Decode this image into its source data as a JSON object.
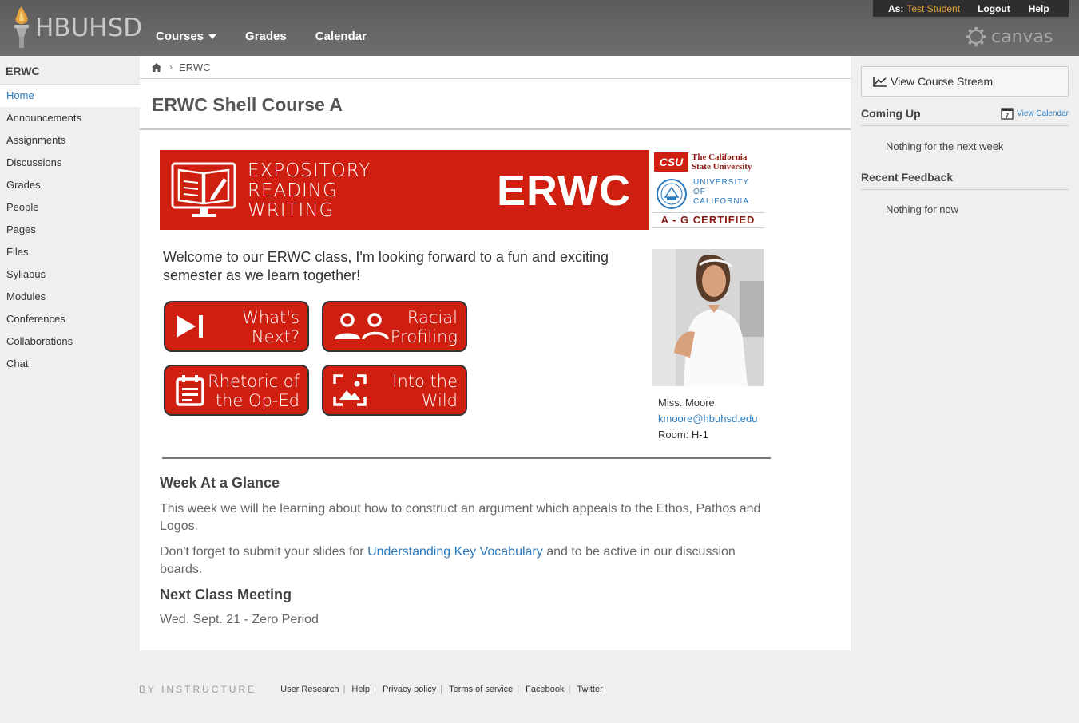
{
  "header": {
    "logo_text": "HBUHSD",
    "nav": {
      "courses": "Courses",
      "grades": "Grades",
      "calendar": "Calendar"
    },
    "user": {
      "as_label": "As:",
      "user_name": "Test Student",
      "logout": "Logout",
      "help": "Help"
    },
    "brand": "canvas",
    "colors": {
      "accent_user": "#e8a33d",
      "bar_bg": "#5c5c5c"
    }
  },
  "sidebar": {
    "course": "ERWC",
    "items": [
      {
        "label": "Home"
      },
      {
        "label": "Announcements"
      },
      {
        "label": "Assignments"
      },
      {
        "label": "Discussions"
      },
      {
        "label": "Grades"
      },
      {
        "label": "People"
      },
      {
        "label": "Pages"
      },
      {
        "label": "Files"
      },
      {
        "label": "Syllabus"
      },
      {
        "label": "Modules"
      },
      {
        "label": "Conferences"
      },
      {
        "label": "Collaborations"
      },
      {
        "label": "Chat"
      }
    ]
  },
  "breadcrumb": {
    "current": "ERWC"
  },
  "page_title": "ERWC Shell Course A",
  "banner": {
    "line1": "EXPOSITORY",
    "line2": "READING",
    "line3": "WRITING",
    "big": "ERWC",
    "csu_abbr": "CSU",
    "csu_line1": "The California",
    "csu_line2": "State University",
    "uc_line1": "UNIVERSITY",
    "uc_line2": "OF",
    "uc_line3": "CALIFORNIA",
    "ag": "A - G CERTIFIED",
    "brand_color": "#cf1f10"
  },
  "welcome": "Welcome to our ERWC class, I'm looking forward to a fun and exciting semester as we learn together!",
  "buttons": {
    "whats_next": {
      "line1": "What's",
      "line2": "Next?",
      "icon": "skip-next-icon"
    },
    "racial": {
      "line1": "Racial",
      "line2": "Profiling",
      "icon": "people-icon"
    },
    "rhetoric": {
      "line1": "Rhetoric of",
      "line2": "the Op-Ed",
      "icon": "calendar-note-icon"
    },
    "wild": {
      "line1": "Into the",
      "line2": "Wild",
      "icon": "image-icon"
    }
  },
  "teacher": {
    "name": "Miss. Moore",
    "email": "kmoore@hbuhsd.edu",
    "room": "Room: H-1"
  },
  "glance": {
    "heading": "Week At a Glance",
    "p1": "This week we will be learning about how to construct an argument which appeals to the Ethos, Pathos and Logos.",
    "p2_before": "Don't forget to submit your slides for ",
    "p2_link": "Understanding Key Vocabulary",
    "p2_after": " and to be active in our discussion boards.",
    "next_heading": "Next Class Meeting",
    "next_text": "Wed. Sept. 21 - Zero Period"
  },
  "right": {
    "stream_btn": "View Course Stream",
    "coming_up": "Coming Up",
    "view_calendar": "View Calendar",
    "calendar_day": "7",
    "coming_text": "Nothing for the next week",
    "recent": "Recent Feedback",
    "recent_text": "Nothing for now"
  },
  "footer": {
    "by": "BY INSTRUCTURE",
    "links": [
      "User Research",
      "Help",
      "Privacy policy",
      "Terms of service",
      "Facebook",
      "Twitter"
    ]
  }
}
